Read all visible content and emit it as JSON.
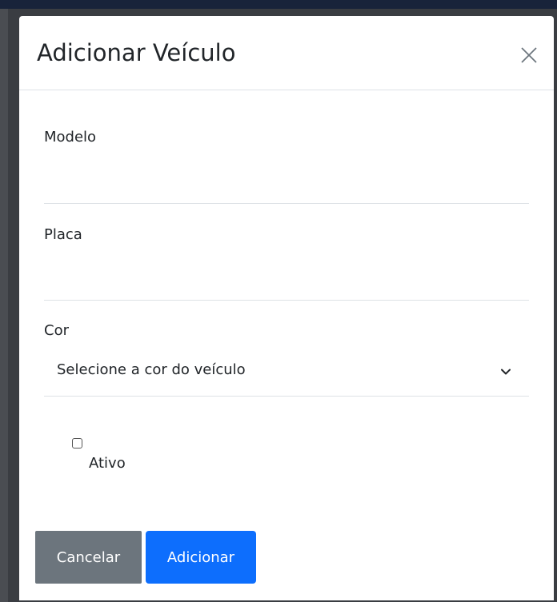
{
  "modal": {
    "title": "Adicionar Veículo",
    "close_icon": "close-icon"
  },
  "form": {
    "modelo": {
      "label": "Modelo",
      "value": ""
    },
    "placa": {
      "label": "Placa",
      "value": ""
    },
    "cor": {
      "label": "Cor",
      "selected": "Selecione a cor do veículo",
      "icon": "chevron-down-icon"
    },
    "ativo": {
      "label": "Ativo",
      "checked": false
    }
  },
  "buttons": {
    "cancel_label": "Cancelar",
    "add_label": "Adicionar"
  },
  "colors": {
    "primary": "#0d6efd",
    "secondary": "#6c757d",
    "backdrop": "#3a3d42"
  }
}
